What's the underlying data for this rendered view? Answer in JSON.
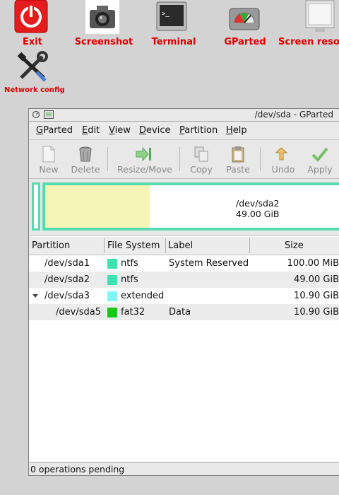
{
  "desktop": {
    "icons": [
      {
        "label": "Exit"
      },
      {
        "label": "Screenshot"
      },
      {
        "label": "Terminal"
      },
      {
        "label": "GParted"
      },
      {
        "label": "Screen reso"
      },
      {
        "label": "Network config"
      }
    ],
    "label_color": "#dd0000"
  },
  "window": {
    "title": "/dev/sda - GParted",
    "menu": [
      "GParted",
      "Edit",
      "View",
      "Device",
      "Partition",
      "Help"
    ],
    "menu_mnemonics": [
      "G",
      "E",
      "V",
      "D",
      "P",
      "H"
    ],
    "toolbar": {
      "new": "New",
      "delete": "Delete",
      "resize": "Resize/Move",
      "copy": "Copy",
      "paste": "Paste",
      "undo": "Undo",
      "apply": "Apply"
    },
    "diskmap": {
      "name": "/dev/sda2",
      "size": "49.00 GiB",
      "used_fraction": 0.35
    },
    "table": {
      "headers": [
        "Partition",
        "File System",
        "Label",
        "Size"
      ],
      "rows": [
        {
          "partition": "/dev/sda1",
          "fs": "ntfs",
          "fs_color": "#42e0b0",
          "label": "System Reserved",
          "size": "100.00 MiB"
        },
        {
          "partition": "/dev/sda2",
          "fs": "ntfs",
          "fs_color": "#42e0b0",
          "label": "",
          "size": "49.00 GiB"
        },
        {
          "partition": "/dev/sda3",
          "fs": "extended",
          "fs_color": "#7ff5f5",
          "label": "",
          "size": "10.90 GiB"
        },
        {
          "partition": "/dev/sda5",
          "fs": "fat32",
          "fs_color": "#18c818",
          "label": "Data",
          "size": "10.90 GiB"
        }
      ]
    },
    "status": "0 operations pending"
  }
}
